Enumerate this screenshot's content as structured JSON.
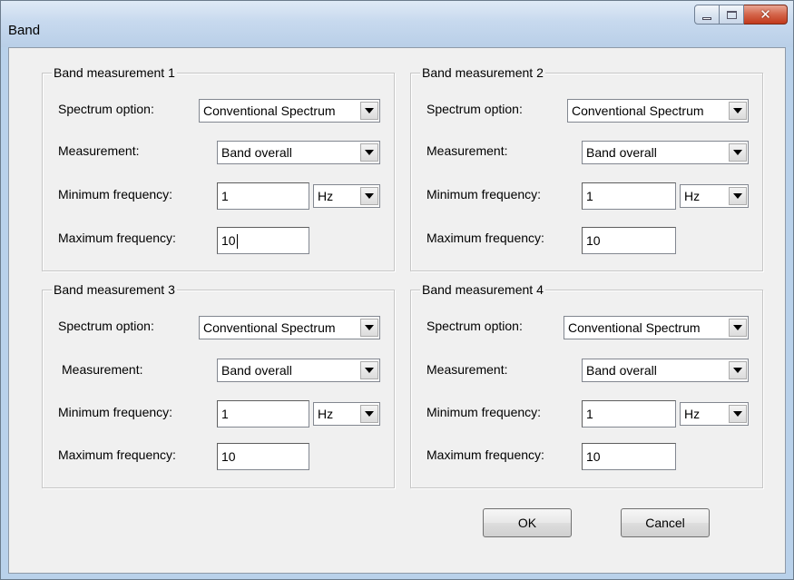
{
  "window": {
    "title": "Band"
  },
  "groups": [
    {
      "label": "Band measurement 1",
      "spectrum_label": "Spectrum option:",
      "spectrum_value": "Conventional Spectrum",
      "measurement_label": "Measurement:",
      "measurement_value": "Band overall",
      "min_label": "Minimum frequency:",
      "min_value": "1",
      "unit_value": "Hz",
      "max_label": "Maximum frequency:",
      "max_value": "10"
    },
    {
      "label": "Band measurement 2",
      "spectrum_label": "Spectrum option:",
      "spectrum_value": "Conventional Spectrum",
      "measurement_label": "Measurement:",
      "measurement_value": "Band overall",
      "min_label": "Minimum frequency:",
      "min_value": "1",
      "unit_value": "Hz",
      "max_label": "Maximum frequency:",
      "max_value": "10"
    },
    {
      "label": "Band measurement 3",
      "spectrum_label": "Spectrum option:",
      "spectrum_value": "Conventional Spectrum",
      "measurement_label": "Measurement:",
      "measurement_value": "Band overall",
      "min_label": "Minimum frequency:",
      "min_value": "1",
      "unit_value": "Hz",
      "max_label": "Maximum frequency:",
      "max_value": "10"
    },
    {
      "label": "Band measurement 4",
      "spectrum_label": "Spectrum option:",
      "spectrum_value": "Conventional Spectrum",
      "measurement_label": "Measurement:",
      "measurement_value": "Band overall",
      "min_label": "Minimum frequency:",
      "min_value": "1",
      "unit_value": "Hz",
      "max_label": "Maximum frequency:",
      "max_value": "10"
    }
  ],
  "buttons": {
    "ok": "OK",
    "cancel": "Cancel"
  },
  "icons": {
    "minimize": "minimize-icon",
    "maximize": "maximize-icon",
    "close": "close-icon",
    "dropdown": "chevron-down-icon"
  },
  "colors": {
    "close_button": "#c1391c",
    "dialog_bg": "#f0f0f0",
    "titlebar": "#c7d9ee"
  }
}
